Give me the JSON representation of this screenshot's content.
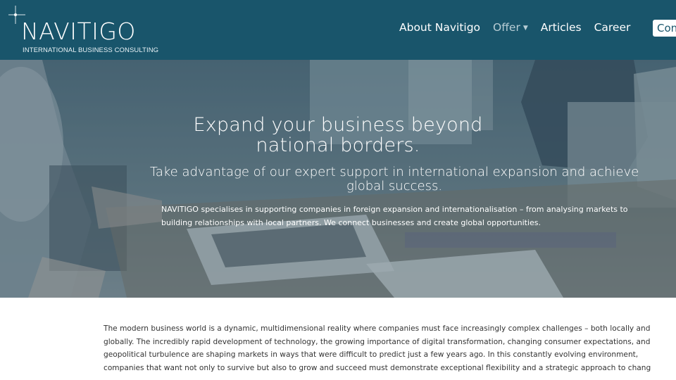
{
  "colors": {
    "header_bg": "#19556b",
    "hero_overlay": "#4f6d7c",
    "nav_muted": "#b8cdd5"
  },
  "logo": {
    "name": "NAVITIGO",
    "tagline": "INTERNATIONAL BUSINESS CONSULTING",
    "icon": "sparkle-star-icon"
  },
  "nav": {
    "about": "About Navitigo",
    "offer": "Offer",
    "offer_icon": "chevron-down-icon",
    "articles": "Articles",
    "career": "Career",
    "contact": "Con"
  },
  "hero": {
    "title": "Expand your business beyond national borders.",
    "subtitle": "Take advantage of our expert support in international expansion and achieve global success.",
    "text": "NAVITIGO specialises in supporting companies in foreign expansion and internationalisation – from analysing markets to building relationships with local partners. We connect businesses and create global opportunities."
  },
  "intro": {
    "lines": [
      "The modern business world is a dynamic, multidimensional reality where companies must face increasingly complex challenges – both locally and",
      "globally. The incredibly rapid development of technology, the growing importance of digital transformation, changing consumer expectations, and",
      "geopolitical turbulence are shaping markets in ways that were difficult to predict just a few years ago. In this constantly evolving environment,",
      "companies that want not only to survive but also to grow and succeed must demonstrate exceptional flexibility and a strategic approach to chang"
    ]
  }
}
